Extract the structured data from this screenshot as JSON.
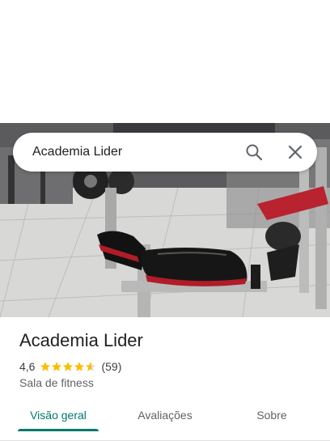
{
  "search": {
    "query": "Academia Lider",
    "search_icon": "search-icon",
    "close_icon": "close-icon"
  },
  "place": {
    "name": "Academia Lider",
    "rating": "4,6",
    "rating_value": 4.6,
    "review_count": "(59)",
    "category": "Sala de fitness"
  },
  "tabs": [
    {
      "label": "Visão geral",
      "active": true
    },
    {
      "label": "Avaliações",
      "active": false
    },
    {
      "label": "Sobre",
      "active": false
    }
  ],
  "colors": {
    "accent": "#00796b",
    "star": "#fbbc04"
  }
}
